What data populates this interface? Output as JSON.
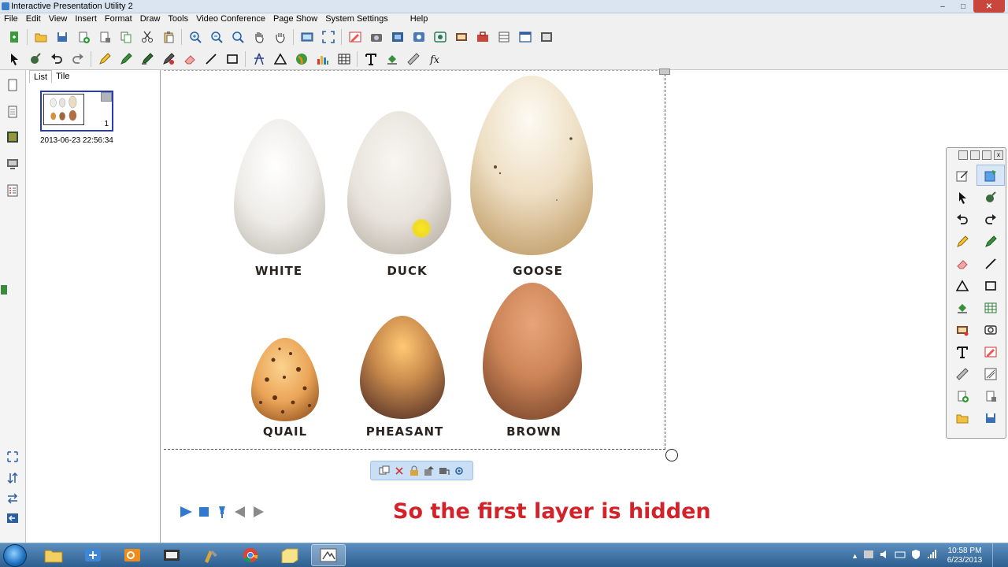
{
  "window": {
    "title": "Interactive Presentation Utility 2"
  },
  "menu": [
    "File",
    "Edit",
    "View",
    "Insert",
    "Format",
    "Draw",
    "Tools",
    "Video Conference",
    "Page Show",
    "System Settings",
    "Help"
  ],
  "panel": {
    "tabs": [
      "List",
      "Tile"
    ],
    "thumbnail": {
      "number": "1",
      "date": "2013-06-23 22:56:34"
    }
  },
  "slide": {
    "eggs": [
      {
        "label": "WHITE",
        "colors": [
          "#f7f6f3",
          "#d9d6cf"
        ]
      },
      {
        "label": "DUCK",
        "colors": [
          "#f2efea",
          "#d2ccc3"
        ]
      },
      {
        "label": "GOOSE",
        "colors": [
          "#f6efe0",
          "#d9c29c"
        ]
      },
      {
        "label": "QUAIL",
        "colors": [
          "#f0b064",
          "#b8742f"
        ]
      },
      {
        "label": "PHEASANT",
        "colors": [
          "#f5b760",
          "#7a5036"
        ]
      },
      {
        "label": "BROWN",
        "colors": [
          "#d79066",
          "#9c5e3d"
        ]
      }
    ]
  },
  "caption": "So the first layer is hidden",
  "taskbar": {
    "time": "10:58 PM",
    "date": "6/23/2013"
  },
  "colors": {
    "caption": "#d2232a",
    "selection_border": "#2a3bb8"
  }
}
